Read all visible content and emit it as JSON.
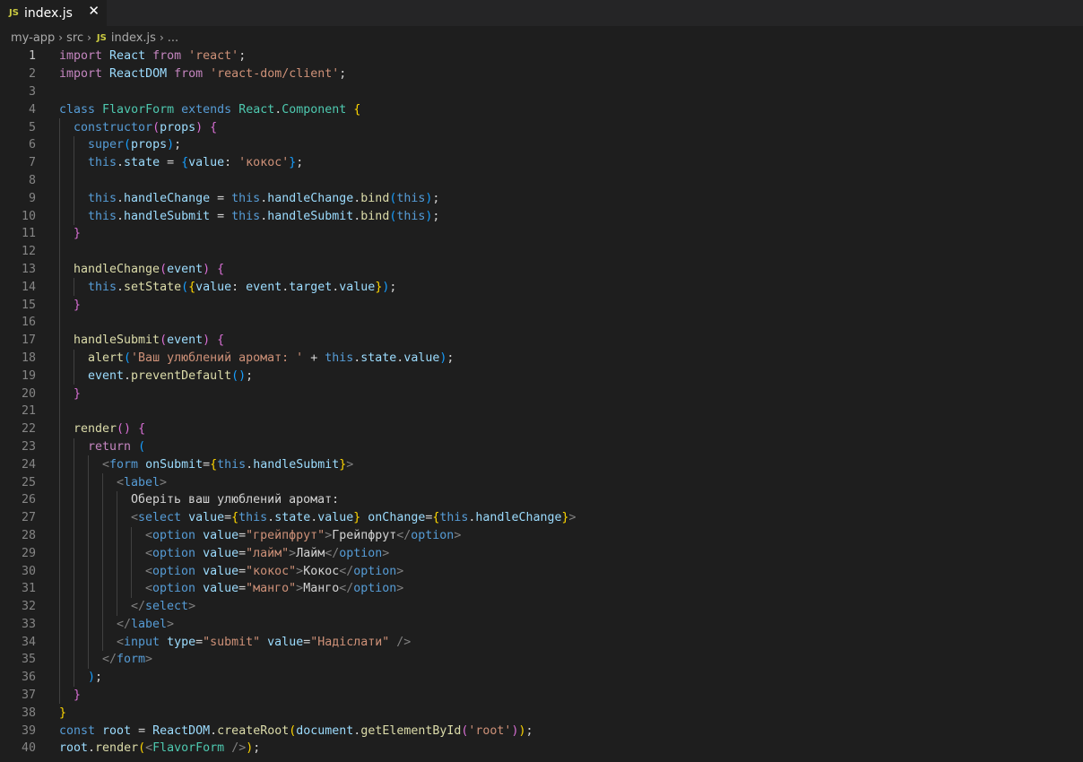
{
  "tab": {
    "icon": "JS",
    "title": "index.js",
    "close": "✕"
  },
  "breadcrumb": [
    "my-app",
    "src",
    "index.js",
    "..."
  ],
  "active_line": 1,
  "lines": [
    {
      "n": "1",
      "indent": 0,
      "tokens": [
        [
          "import",
          "ctl"
        ],
        [
          " React ",
          "var"
        ],
        [
          "from",
          "ctl"
        ],
        [
          " ",
          "txt"
        ],
        [
          "'react'",
          "str"
        ],
        [
          ";",
          "txt"
        ]
      ]
    },
    {
      "n": "2",
      "indent": 0,
      "tokens": [
        [
          "import",
          "ctl"
        ],
        [
          " ReactDOM ",
          "var"
        ],
        [
          "from",
          "ctl"
        ],
        [
          " ",
          "txt"
        ],
        [
          "'react-dom/client'",
          "str"
        ],
        [
          ";",
          "txt"
        ]
      ]
    },
    {
      "n": "3",
      "indent": 0,
      "tokens": []
    },
    {
      "n": "4",
      "indent": 0,
      "tokens": [
        [
          "class",
          "kw"
        ],
        [
          " ",
          "txt"
        ],
        [
          "FlavorForm",
          "cls"
        ],
        [
          " ",
          "txt"
        ],
        [
          "extends",
          "kw"
        ],
        [
          " ",
          "txt"
        ],
        [
          "React",
          "cls"
        ],
        [
          ".",
          "txt"
        ],
        [
          "Component",
          "cls"
        ],
        [
          " ",
          "txt"
        ],
        [
          "{",
          "b1"
        ]
      ]
    },
    {
      "n": "5",
      "indent": 1,
      "tokens": [
        [
          "constructor",
          "kw"
        ],
        [
          "(",
          "b2"
        ],
        [
          "props",
          "var"
        ],
        [
          ")",
          "b2"
        ],
        [
          " ",
          "txt"
        ],
        [
          "{",
          "b2"
        ]
      ]
    },
    {
      "n": "6",
      "indent": 2,
      "tokens": [
        [
          "super",
          "kw"
        ],
        [
          "(",
          "b3"
        ],
        [
          "props",
          "var"
        ],
        [
          ")",
          "b3"
        ],
        [
          ";",
          "txt"
        ]
      ]
    },
    {
      "n": "7",
      "indent": 2,
      "tokens": [
        [
          "this",
          "kw"
        ],
        [
          ".",
          "txt"
        ],
        [
          "state",
          "var"
        ],
        [
          " = ",
          "txt"
        ],
        [
          "{",
          "b3"
        ],
        [
          "value",
          "var"
        ],
        [
          ": ",
          "txt"
        ],
        [
          "'кокос'",
          "str"
        ],
        [
          "}",
          "b3"
        ],
        [
          ";",
          "txt"
        ]
      ]
    },
    {
      "n": "8",
      "indent": 2,
      "tokens": []
    },
    {
      "n": "9",
      "indent": 2,
      "tokens": [
        [
          "this",
          "kw"
        ],
        [
          ".",
          "txt"
        ],
        [
          "handleChange",
          "var"
        ],
        [
          " = ",
          "txt"
        ],
        [
          "this",
          "kw"
        ],
        [
          ".",
          "txt"
        ],
        [
          "handleChange",
          "var"
        ],
        [
          ".",
          "txt"
        ],
        [
          "bind",
          "fn"
        ],
        [
          "(",
          "b3"
        ],
        [
          "this",
          "kw"
        ],
        [
          ")",
          "b3"
        ],
        [
          ";",
          "txt"
        ]
      ]
    },
    {
      "n": "10",
      "indent": 2,
      "tokens": [
        [
          "this",
          "kw"
        ],
        [
          ".",
          "txt"
        ],
        [
          "handleSubmit",
          "var"
        ],
        [
          " = ",
          "txt"
        ],
        [
          "this",
          "kw"
        ],
        [
          ".",
          "txt"
        ],
        [
          "handleSubmit",
          "var"
        ],
        [
          ".",
          "txt"
        ],
        [
          "bind",
          "fn"
        ],
        [
          "(",
          "b3"
        ],
        [
          "this",
          "kw"
        ],
        [
          ")",
          "b3"
        ],
        [
          ";",
          "txt"
        ]
      ]
    },
    {
      "n": "11",
      "indent": 1,
      "tokens": [
        [
          "}",
          "b2"
        ]
      ]
    },
    {
      "n": "12",
      "indent": 1,
      "tokens": []
    },
    {
      "n": "13",
      "indent": 1,
      "tokens": [
        [
          "handleChange",
          "fn"
        ],
        [
          "(",
          "b2"
        ],
        [
          "event",
          "var"
        ],
        [
          ")",
          "b2"
        ],
        [
          " ",
          "txt"
        ],
        [
          "{",
          "b2"
        ]
      ]
    },
    {
      "n": "14",
      "indent": 2,
      "tokens": [
        [
          "this",
          "kw"
        ],
        [
          ".",
          "txt"
        ],
        [
          "setState",
          "fn"
        ],
        [
          "(",
          "b3"
        ],
        [
          "{",
          "b1"
        ],
        [
          "value",
          "var"
        ],
        [
          ": ",
          "txt"
        ],
        [
          "event",
          "var"
        ],
        [
          ".",
          "txt"
        ],
        [
          "target",
          "var"
        ],
        [
          ".",
          "txt"
        ],
        [
          "value",
          "var"
        ],
        [
          "}",
          "b1"
        ],
        [
          ")",
          "b3"
        ],
        [
          ";",
          "txt"
        ]
      ]
    },
    {
      "n": "15",
      "indent": 1,
      "tokens": [
        [
          "}",
          "b2"
        ]
      ]
    },
    {
      "n": "16",
      "indent": 1,
      "tokens": []
    },
    {
      "n": "17",
      "indent": 1,
      "tokens": [
        [
          "handleSubmit",
          "fn"
        ],
        [
          "(",
          "b2"
        ],
        [
          "event",
          "var"
        ],
        [
          ")",
          "b2"
        ],
        [
          " ",
          "txt"
        ],
        [
          "{",
          "b2"
        ]
      ]
    },
    {
      "n": "18",
      "indent": 2,
      "tokens": [
        [
          "alert",
          "fn"
        ],
        [
          "(",
          "b3"
        ],
        [
          "'Ваш улюблений аромат: '",
          "str"
        ],
        [
          " + ",
          "txt"
        ],
        [
          "this",
          "kw"
        ],
        [
          ".",
          "txt"
        ],
        [
          "state",
          "var"
        ],
        [
          ".",
          "txt"
        ],
        [
          "value",
          "var"
        ],
        [
          ")",
          "b3"
        ],
        [
          ";",
          "txt"
        ]
      ]
    },
    {
      "n": "19",
      "indent": 2,
      "tokens": [
        [
          "event",
          "var"
        ],
        [
          ".",
          "txt"
        ],
        [
          "preventDefault",
          "fn"
        ],
        [
          "()",
          "b3"
        ],
        [
          ";",
          "txt"
        ]
      ]
    },
    {
      "n": "20",
      "indent": 1,
      "tokens": [
        [
          "}",
          "b2"
        ]
      ]
    },
    {
      "n": "21",
      "indent": 1,
      "tokens": []
    },
    {
      "n": "22",
      "indent": 1,
      "tokens": [
        [
          "render",
          "fn"
        ],
        [
          "()",
          "b2"
        ],
        [
          " ",
          "txt"
        ],
        [
          "{",
          "b2"
        ]
      ]
    },
    {
      "n": "23",
      "indent": 2,
      "tokens": [
        [
          "return",
          "ctl"
        ],
        [
          " ",
          "txt"
        ],
        [
          "(",
          "b3"
        ]
      ]
    },
    {
      "n": "24",
      "indent": 3,
      "tokens": [
        [
          "<",
          "pt"
        ],
        [
          "form",
          "tag"
        ],
        [
          " ",
          "txt"
        ],
        [
          "onSubmit",
          "attr"
        ],
        [
          "=",
          "txt"
        ],
        [
          "{",
          "b1"
        ],
        [
          "this",
          "kw"
        ],
        [
          ".",
          "txt"
        ],
        [
          "handleSubmit",
          "var"
        ],
        [
          "}",
          "b1"
        ],
        [
          ">",
          "pt"
        ]
      ]
    },
    {
      "n": "25",
      "indent": 4,
      "tokens": [
        [
          "<",
          "pt"
        ],
        [
          "label",
          "tag"
        ],
        [
          ">",
          "pt"
        ]
      ]
    },
    {
      "n": "26",
      "indent": 5,
      "tokens": [
        [
          "Оберіть ваш улюблений аромат:",
          "txt"
        ]
      ]
    },
    {
      "n": "27",
      "indent": 5,
      "tokens": [
        [
          "<",
          "pt"
        ],
        [
          "select",
          "tag"
        ],
        [
          " ",
          "txt"
        ],
        [
          "value",
          "attr"
        ],
        [
          "=",
          "txt"
        ],
        [
          "{",
          "b1"
        ],
        [
          "this",
          "kw"
        ],
        [
          ".",
          "txt"
        ],
        [
          "state",
          "var"
        ],
        [
          ".",
          "txt"
        ],
        [
          "value",
          "var"
        ],
        [
          "}",
          "b1"
        ],
        [
          " ",
          "txt"
        ],
        [
          "onChange",
          "attr"
        ],
        [
          "=",
          "txt"
        ],
        [
          "{",
          "b1"
        ],
        [
          "this",
          "kw"
        ],
        [
          ".",
          "txt"
        ],
        [
          "handleChange",
          "var"
        ],
        [
          "}",
          "b1"
        ],
        [
          ">",
          "pt"
        ]
      ]
    },
    {
      "n": "28",
      "indent": 6,
      "tokens": [
        [
          "<",
          "pt"
        ],
        [
          "option",
          "tag"
        ],
        [
          " ",
          "txt"
        ],
        [
          "value",
          "attr"
        ],
        [
          "=",
          "txt"
        ],
        [
          "\"грейпфрут\"",
          "str"
        ],
        [
          ">",
          "pt"
        ],
        [
          "Грейпфрут",
          "txt"
        ],
        [
          "</",
          "pt"
        ],
        [
          "option",
          "tag"
        ],
        [
          ">",
          "pt"
        ]
      ]
    },
    {
      "n": "29",
      "indent": 6,
      "tokens": [
        [
          "<",
          "pt"
        ],
        [
          "option",
          "tag"
        ],
        [
          " ",
          "txt"
        ],
        [
          "value",
          "attr"
        ],
        [
          "=",
          "txt"
        ],
        [
          "\"лайм\"",
          "str"
        ],
        [
          ">",
          "pt"
        ],
        [
          "Лайм",
          "txt"
        ],
        [
          "</",
          "pt"
        ],
        [
          "option",
          "tag"
        ],
        [
          ">",
          "pt"
        ]
      ]
    },
    {
      "n": "30",
      "indent": 6,
      "tokens": [
        [
          "<",
          "pt"
        ],
        [
          "option",
          "tag"
        ],
        [
          " ",
          "txt"
        ],
        [
          "value",
          "attr"
        ],
        [
          "=",
          "txt"
        ],
        [
          "\"кокос\"",
          "str"
        ],
        [
          ">",
          "pt"
        ],
        [
          "Кокос",
          "txt"
        ],
        [
          "</",
          "pt"
        ],
        [
          "option",
          "tag"
        ],
        [
          ">",
          "pt"
        ]
      ]
    },
    {
      "n": "31",
      "indent": 6,
      "tokens": [
        [
          "<",
          "pt"
        ],
        [
          "option",
          "tag"
        ],
        [
          " ",
          "txt"
        ],
        [
          "value",
          "attr"
        ],
        [
          "=",
          "txt"
        ],
        [
          "\"манго\"",
          "str"
        ],
        [
          ">",
          "pt"
        ],
        [
          "Манго",
          "txt"
        ],
        [
          "</",
          "pt"
        ],
        [
          "option",
          "tag"
        ],
        [
          ">",
          "pt"
        ]
      ]
    },
    {
      "n": "32",
      "indent": 5,
      "tokens": [
        [
          "</",
          "pt"
        ],
        [
          "select",
          "tag"
        ],
        [
          ">",
          "pt"
        ]
      ]
    },
    {
      "n": "33",
      "indent": 4,
      "tokens": [
        [
          "</",
          "pt"
        ],
        [
          "label",
          "tag"
        ],
        [
          ">",
          "pt"
        ]
      ]
    },
    {
      "n": "34",
      "indent": 4,
      "tokens": [
        [
          "<",
          "pt"
        ],
        [
          "input",
          "tag"
        ],
        [
          " ",
          "txt"
        ],
        [
          "type",
          "attr"
        ],
        [
          "=",
          "txt"
        ],
        [
          "\"submit\"",
          "str"
        ],
        [
          " ",
          "txt"
        ],
        [
          "value",
          "attr"
        ],
        [
          "=",
          "txt"
        ],
        [
          "\"Надіслати\"",
          "str"
        ],
        [
          " ",
          "txt"
        ],
        [
          "/>",
          "pt"
        ]
      ]
    },
    {
      "n": "35",
      "indent": 3,
      "tokens": [
        [
          "</",
          "pt"
        ],
        [
          "form",
          "tag"
        ],
        [
          ">",
          "pt"
        ]
      ]
    },
    {
      "n": "36",
      "indent": 2,
      "tokens": [
        [
          ")",
          "b3"
        ],
        [
          ";",
          "txt"
        ]
      ]
    },
    {
      "n": "37",
      "indent": 1,
      "tokens": [
        [
          "}",
          "b2"
        ]
      ]
    },
    {
      "n": "38",
      "indent": 0,
      "tokens": [
        [
          "}",
          "b1"
        ]
      ]
    },
    {
      "n": "39",
      "indent": 0,
      "tokens": [
        [
          "const",
          "kw"
        ],
        [
          " ",
          "txt"
        ],
        [
          "root",
          "var"
        ],
        [
          " = ",
          "txt"
        ],
        [
          "ReactDOM",
          "var"
        ],
        [
          ".",
          "txt"
        ],
        [
          "createRoot",
          "fn"
        ],
        [
          "(",
          "b1"
        ],
        [
          "document",
          "var"
        ],
        [
          ".",
          "txt"
        ],
        [
          "getElementById",
          "fn"
        ],
        [
          "(",
          "b2"
        ],
        [
          "'root'",
          "str"
        ],
        [
          ")",
          "b2"
        ],
        [
          ")",
          "b1"
        ],
        [
          ";",
          "txt"
        ]
      ]
    },
    {
      "n": "40",
      "indent": 0,
      "tokens": [
        [
          "root",
          "var"
        ],
        [
          ".",
          "txt"
        ],
        [
          "render",
          "fn"
        ],
        [
          "(",
          "b1"
        ],
        [
          "<",
          "pt"
        ],
        [
          "FlavorForm",
          "cls"
        ],
        [
          " ",
          "txt"
        ],
        [
          "/>",
          "pt"
        ],
        [
          ")",
          "b1"
        ],
        [
          ";",
          "txt"
        ]
      ]
    }
  ]
}
